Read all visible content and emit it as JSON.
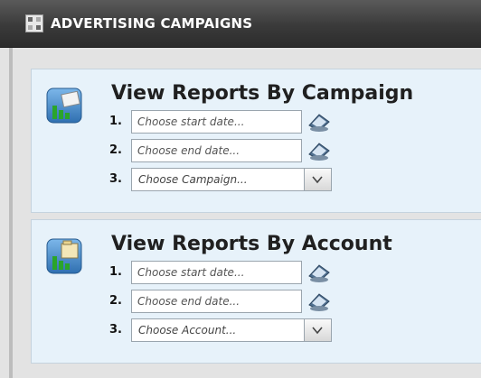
{
  "header": {
    "title": "ADVERTISING CAMPAIGNS"
  },
  "panels": [
    {
      "title": "View Reports By Campaign",
      "rows": [
        {
          "num": "1.",
          "placeholder": "Choose start date..."
        },
        {
          "num": "2.",
          "placeholder": "Choose end date..."
        },
        {
          "num": "3.",
          "select_value": "Choose Campaign..."
        }
      ]
    },
    {
      "title": "View Reports By Account",
      "rows": [
        {
          "num": "1.",
          "placeholder": "Choose start date..."
        },
        {
          "num": "2.",
          "placeholder": "Choose end date..."
        },
        {
          "num": "3.",
          "select_value": "Choose Account..."
        }
      ]
    }
  ],
  "colors": {
    "header_bg": "#3a3a3a",
    "panel_bg": "#e7f2fa",
    "icon_blue": "#3f87c8",
    "chart_green": "#2aa52a"
  },
  "icons": [
    "grid-icon",
    "report-chart-icon",
    "calendar-icon",
    "chevron-down-icon"
  ]
}
